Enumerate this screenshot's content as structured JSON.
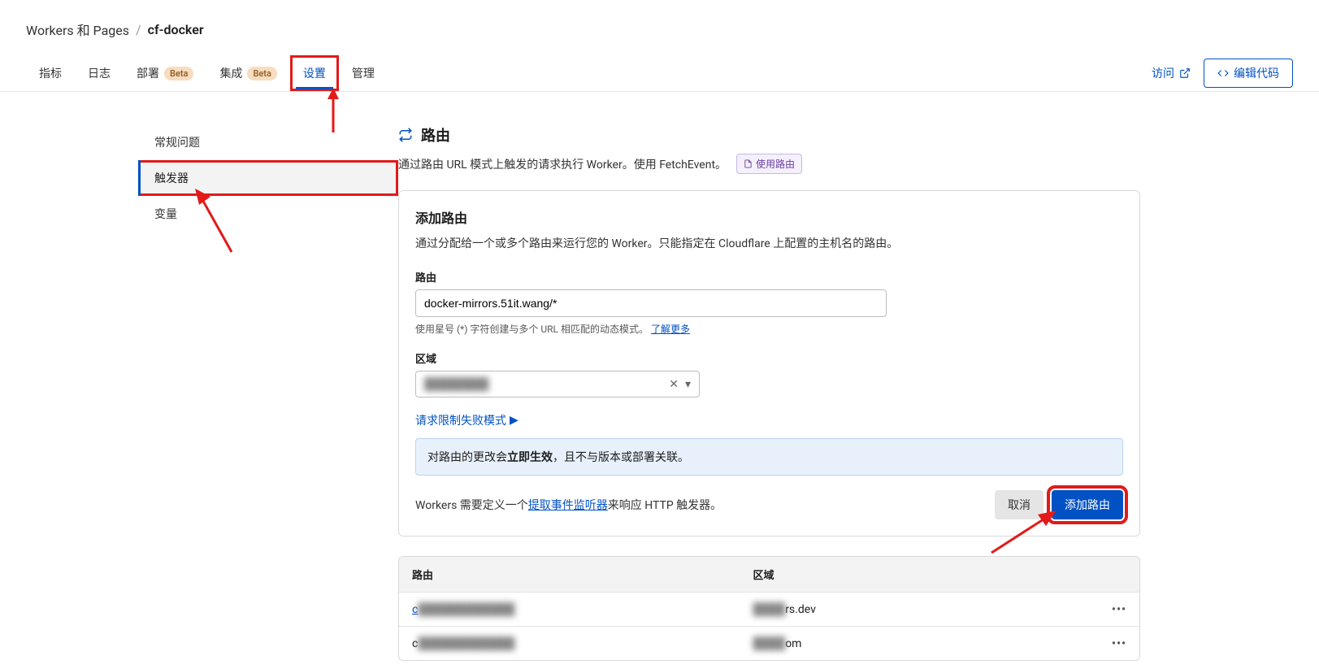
{
  "breadcrumb": {
    "parent": "Workers 和 Pages",
    "sep": "/",
    "current": "cf-docker"
  },
  "tabs": {
    "metrics": "指标",
    "logs": "日志",
    "deployments": "部署",
    "integrations": "集成",
    "settings": "设置",
    "manage": "管理",
    "beta_badge": "Beta"
  },
  "header_actions": {
    "visit": "访问",
    "edit_code": "编辑代码"
  },
  "sidebar": {
    "general": "常规问题",
    "triggers": "触发器",
    "variables": "变量"
  },
  "section": {
    "title": "路由",
    "desc": "通过路由 URL 模式上触发的请求执行 Worker。使用 FetchEvent。",
    "doc_badge": "使用路由"
  },
  "panel": {
    "title": "添加路由",
    "desc": "通过分配给一个或多个路由来运行您的 Worker。只能指定在 Cloudflare 上配置的主机名的路由。",
    "route_label": "路由",
    "route_value": "docker-mirrors.51it.wang/*",
    "route_hint_prefix": "使用星号 (*) 字符创建与多个 URL 相匹配的动态模式。",
    "route_hint_link": "了解更多",
    "zone_label": "区域",
    "zone_value": "████████",
    "fail_mode_link": "请求限制失败模式",
    "info_prefix": "对路由的更改会",
    "info_bold": "立即生效",
    "info_suffix": "，且不与版本或部署关联。",
    "footer_note_prefix": "Workers 需要定义一个",
    "footer_note_link": "提取事件监听器",
    "footer_note_suffix": "来响应 HTTP 触发器。",
    "cancel": "取消",
    "submit": "添加路由"
  },
  "table": {
    "col_route": "路由",
    "col_zone": "区域",
    "rows": [
      {
        "route_prefix": "c",
        "route_blur": "████████████",
        "zone_blur": "████",
        "zone_suffix": "rs.dev"
      },
      {
        "route_prefix": "c",
        "route_blur": "████████████",
        "zone_blur": "████",
        "zone_suffix": "om"
      }
    ],
    "actions": "•••"
  }
}
